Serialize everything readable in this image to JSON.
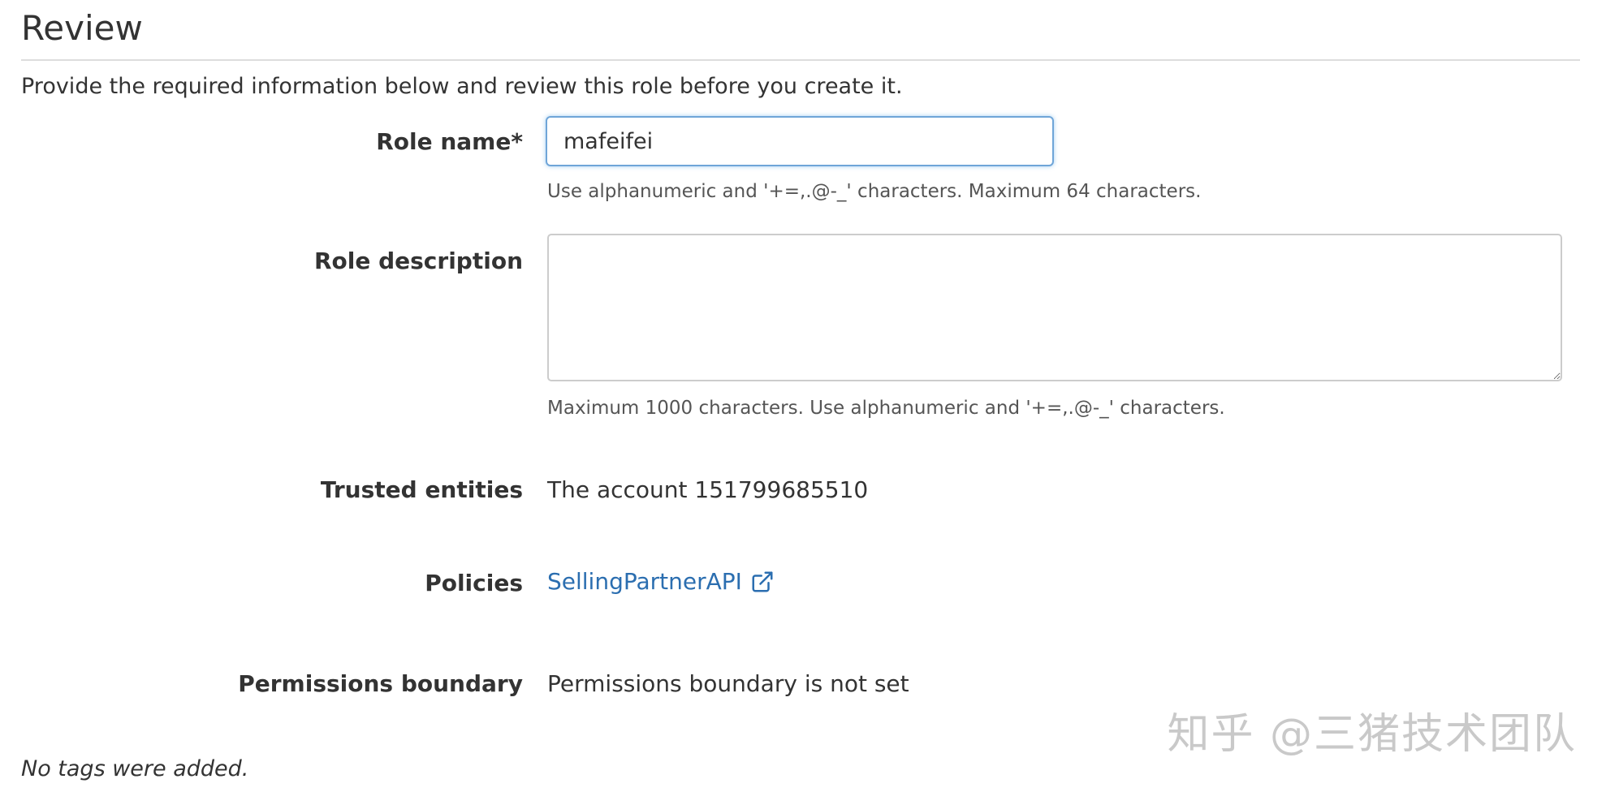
{
  "header": {
    "title": "Review",
    "intro": "Provide the required information below and review this role before you create it."
  },
  "role_name": {
    "label": "Role name*",
    "value": "mafeifei",
    "help": "Use alphanumeric and '+=,.@-_' characters. Maximum 64 characters."
  },
  "role_description": {
    "label": "Role description",
    "value": "",
    "help": "Maximum 1000 characters. Use alphanumeric and '+=,.@-_' characters."
  },
  "trusted_entities": {
    "label": "Trusted entities",
    "value": "The account 151799685510"
  },
  "policies": {
    "label": "Policies",
    "link_text": "SellingPartnerAPI",
    "icon": "external-link-icon",
    "link_color": "#2b6eb0"
  },
  "permissions_boundary": {
    "label": "Permissions boundary",
    "value": "Permissions boundary is not set"
  },
  "tags": {
    "message": "No tags were added."
  },
  "watermark": {
    "text": "知乎 @三猪技术团队"
  }
}
